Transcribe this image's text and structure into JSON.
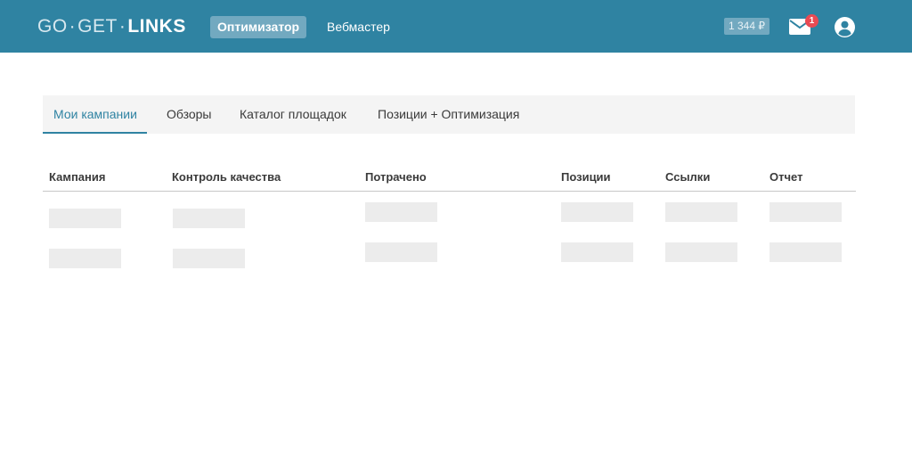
{
  "brand": {
    "part1": "GO",
    "sep1": "·",
    "part2": "GET",
    "sep2": "·",
    "part3": "LINKS"
  },
  "nav": {
    "optimizer": "Оптимизатор",
    "webmaster": "Вебмастер"
  },
  "account": {
    "balance": "1 344 ₽",
    "mail_count": "1"
  },
  "tabs": [
    {
      "label": "Мои кампании"
    },
    {
      "label": "Обзоры"
    },
    {
      "label": "Каталог площадок"
    },
    {
      "label": "Позиции + Оптимизация"
    }
  ],
  "table": {
    "columns": [
      "Кампания",
      "Контроль качества",
      "Потрачено",
      "Позиции",
      "Ссылки",
      "Отчет"
    ]
  },
  "colors": {
    "header_bg": "#2f83a2",
    "accent": "#2f83a2",
    "badge": "#e94a53",
    "placeholder": "#ececec"
  }
}
